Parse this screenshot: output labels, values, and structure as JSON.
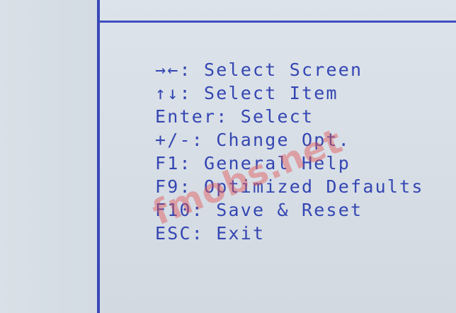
{
  "screen": {
    "help_items": [
      {
        "key": "→←",
        "sep": ": ",
        "action": "Select Screen"
      },
      {
        "key": "↑↓",
        "sep": ": ",
        "action": "Select Item"
      },
      {
        "key": "Enter",
        "sep": ": ",
        "action": "Select"
      },
      {
        "key": "+/-",
        "sep": ": ",
        "action": "Change Opt."
      },
      {
        "key": "F1",
        "sep": ": ",
        "action": "General Help"
      },
      {
        "key": "F9",
        "sep": ": ",
        "action": "Optimized Defaults"
      },
      {
        "key": "F10",
        "sep": ": ",
        "action": "Save & Reset"
      },
      {
        "key": "ESC",
        "sep": ": ",
        "action": "Exit"
      }
    ],
    "watermark": "fmobs.net"
  },
  "colors": {
    "background": "#d5dde5",
    "text": "#3446b2",
    "rule": "#3848b8",
    "watermark": "#e25454"
  },
  "icons": {
    "left_right": "left-right-arrows-icon",
    "up_down": "up-down-arrows-icon"
  }
}
